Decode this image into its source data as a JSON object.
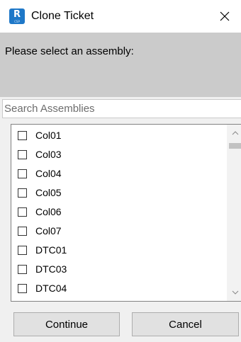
{
  "window": {
    "title": "Clone Ticket",
    "icon_letter": "R",
    "icon_sub": "CSP",
    "close_icon": "close-x-icon"
  },
  "prompt": {
    "text": "Please select an assembly:"
  },
  "search": {
    "placeholder": "Search Assemblies",
    "value": ""
  },
  "assemblies": {
    "items": [
      {
        "label": "Col01",
        "checked": false
      },
      {
        "label": "Col03",
        "checked": false
      },
      {
        "label": "Col04",
        "checked": false
      },
      {
        "label": "Col05",
        "checked": false
      },
      {
        "label": "Col06",
        "checked": false
      },
      {
        "label": "Col07",
        "checked": false
      },
      {
        "label": "DTC01",
        "checked": false
      },
      {
        "label": "DTC03",
        "checked": false
      },
      {
        "label": "DTC04",
        "checked": false
      }
    ]
  },
  "buttons": {
    "continue_label": "Continue",
    "cancel_label": "Cancel"
  },
  "colors": {
    "accent_icon": "#1e78c8",
    "prompt_background": "#cbcbcb",
    "window_background": "#f0f0f0"
  }
}
